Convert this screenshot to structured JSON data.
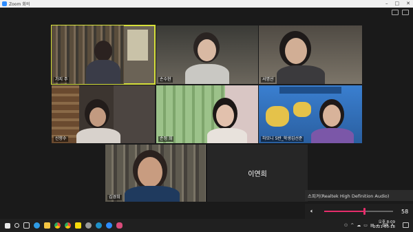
{
  "window": {
    "title": "Zoom 회의"
  },
  "participants": [
    {
      "name": "가지 주",
      "active": true
    },
    {
      "name": "손수현",
      "active": false
    },
    {
      "name": "서명선",
      "active": false
    },
    {
      "name": "신향수",
      "active": false
    },
    {
      "name": "손정 희",
      "active": false
    },
    {
      "name": "하모니 5반_학생김선준",
      "active": false
    },
    {
      "name": "김경희",
      "active": false
    }
  ],
  "video_off_participant": {
    "name": "이연희"
  },
  "audio": {
    "device_label": "스피커(Realtek High Definition Audio)",
    "volume": 58
  },
  "taskbar": {
    "time": "오후 8:09",
    "date": "2021-03-18"
  },
  "colors": {
    "active_border": "#d8e23b",
    "volume_accent": "#e62e6b"
  }
}
